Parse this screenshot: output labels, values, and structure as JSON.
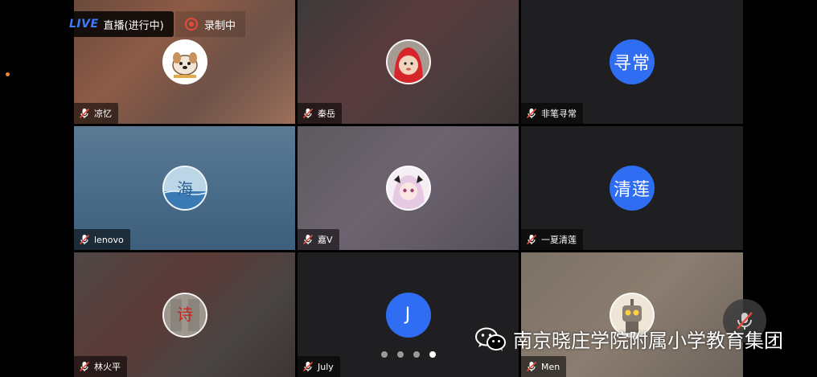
{
  "header": {
    "live_badge": "LIVE",
    "live_status": "直播(进行中)",
    "record_status": "录制中"
  },
  "tiles": [
    {
      "name": "凉忆",
      "avatar_type": "image",
      "avatar_desc": "cartoon-dog"
    },
    {
      "name": "秦岳",
      "avatar_type": "image",
      "avatar_desc": "child-in-red-hood"
    },
    {
      "name": "非笔寻常",
      "avatar_type": "text",
      "avatar_text": "寻常"
    },
    {
      "name": "lenovo",
      "avatar_type": "image",
      "avatar_desc": "sea-calligraphy"
    },
    {
      "name": "嘉V",
      "avatar_type": "image",
      "avatar_desc": "anime-girl"
    },
    {
      "name": "一夏清莲",
      "avatar_type": "text",
      "avatar_text": "清莲"
    },
    {
      "name": "林火平",
      "avatar_type": "image",
      "avatar_desc": "red-calligraphy"
    },
    {
      "name": "July",
      "avatar_type": "text",
      "avatar_text": "J"
    },
    {
      "name": "Men",
      "avatar_type": "image",
      "avatar_desc": "robot-toy"
    }
  ],
  "pager": {
    "pages": 4,
    "active": 4
  },
  "watermark": {
    "text": "南京晓庄学院附属小学教育集团"
  },
  "colors": {
    "accent": "#2f6ef3",
    "live": "#3d7bff",
    "record": "#e64a3b"
  }
}
